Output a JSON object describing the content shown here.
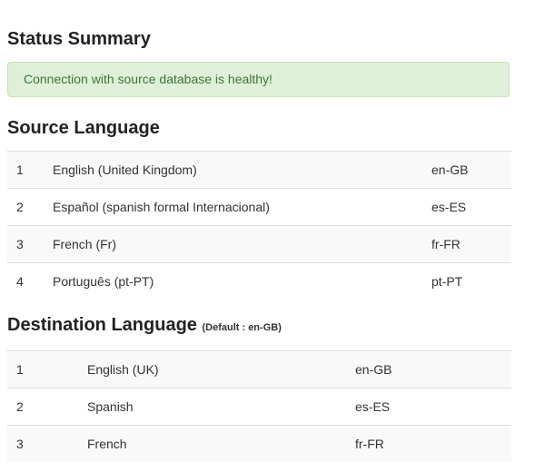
{
  "status": {
    "title": "Status Summary",
    "message": "Connection with source database is healthy!"
  },
  "source": {
    "title": "Source Language",
    "rows": [
      {
        "num": "1",
        "name": "English (United Kingdom)",
        "code": "en-GB"
      },
      {
        "num": "2",
        "name": "Español (spanish formal Internacional)",
        "code": "es-ES"
      },
      {
        "num": "3",
        "name": "French (Fr)",
        "code": "fr-FR"
      },
      {
        "num": "4",
        "name": "Português (pt-PT)",
        "code": "pt-PT"
      }
    ]
  },
  "destination": {
    "title": "Destination Language",
    "default_note": "(Default : en-GB)",
    "rows": [
      {
        "num": "1",
        "name": "English (UK)",
        "code": "en-GB"
      },
      {
        "num": "2",
        "name": "Spanish",
        "code": "es-ES"
      },
      {
        "num": "3",
        "name": "French",
        "code": "fr-FR"
      }
    ]
  },
  "colors": {
    "alert_bg": "#dff0d8",
    "alert_text": "#3c763d",
    "row_stripe": "#f9f9f9"
  }
}
